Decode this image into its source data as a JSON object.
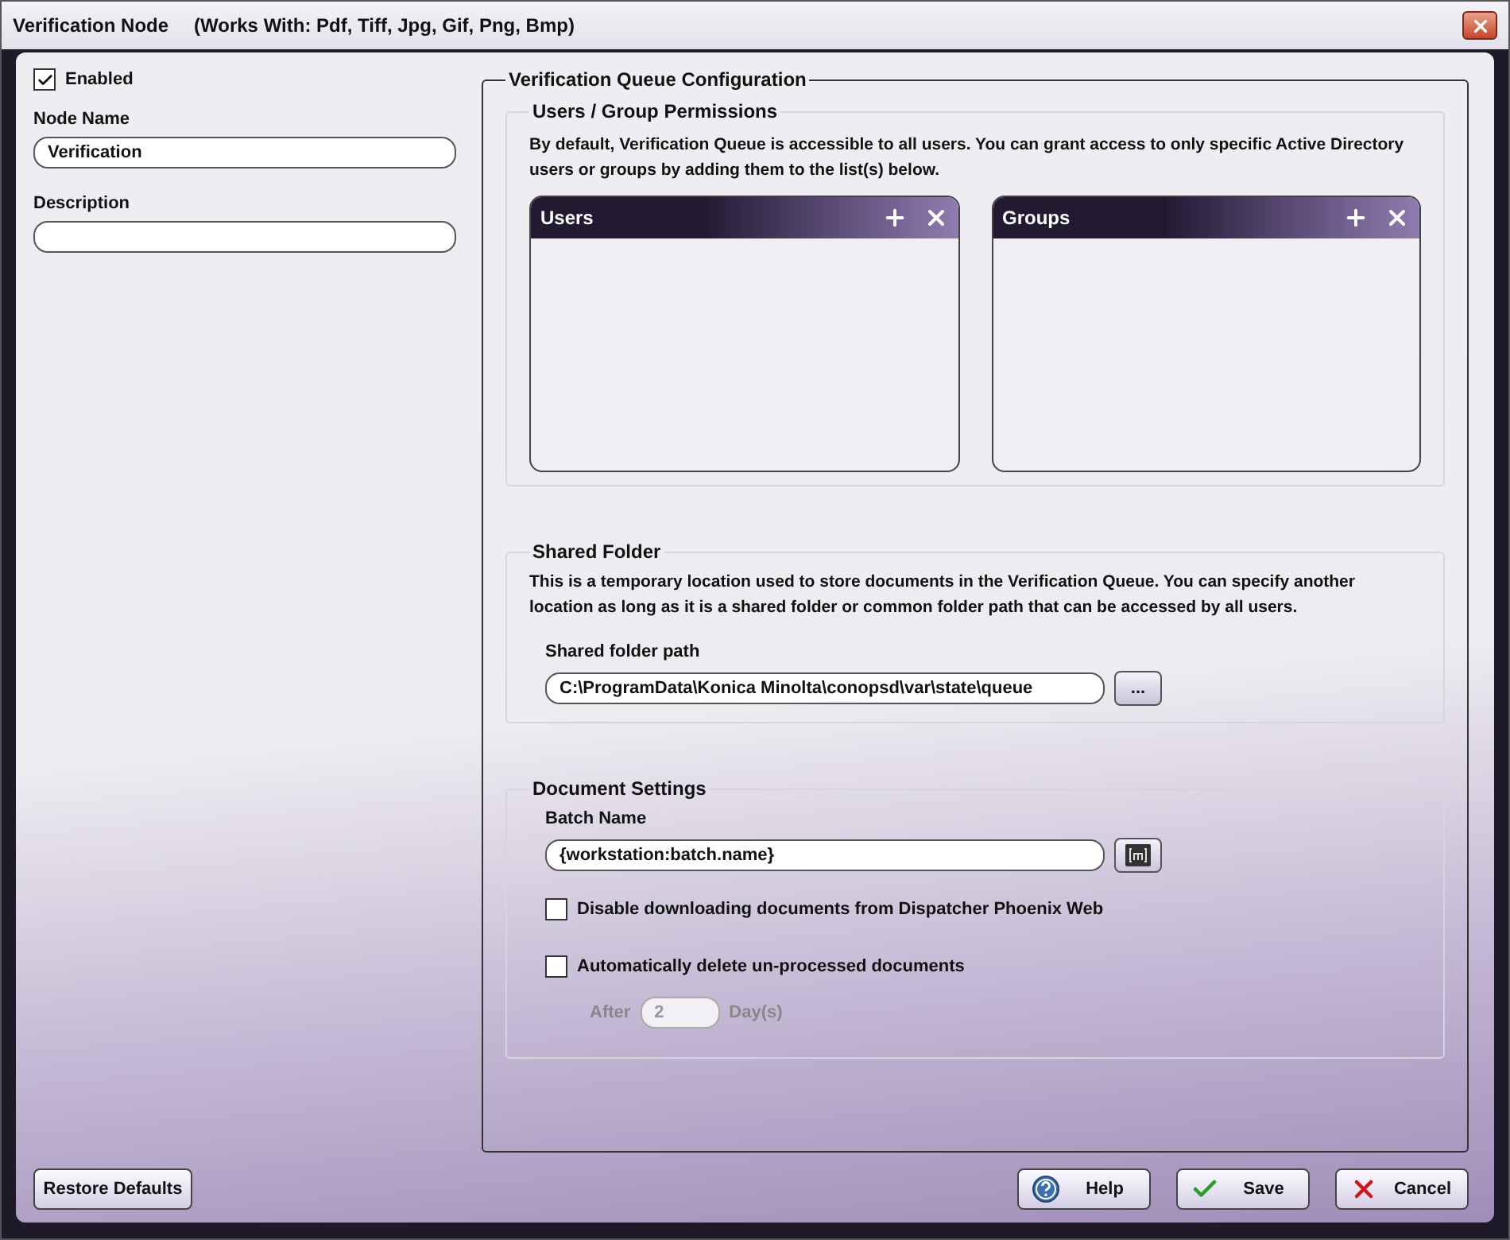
{
  "window": {
    "title": "Verification Node",
    "subtitle": "(Works With: Pdf, Tiff, Jpg, Gif, Png, Bmp)"
  },
  "general": {
    "enabled": {
      "label": "Enabled",
      "checked": true
    },
    "node_name": {
      "label": "Node Name",
      "value": "Verification"
    },
    "description": {
      "label": "Description"
    }
  },
  "config": {
    "title": "Verification Queue Configuration",
    "permissions": {
      "title": "Users / Group Permissions",
      "description": "By default, Verification Queue is accessible to all users. You can grant access to only specific Active Directory users or groups by adding them to the list(s) below.",
      "lists": [
        {
          "title": "Users"
        },
        {
          "title": "Groups"
        }
      ]
    },
    "shared_folder": {
      "title": "Shared Folder",
      "description": "This is a temporary location used to store documents in the Verification Queue. You can specify another location as long as it is a shared folder or common folder path that can be accessed by all users.",
      "path_label": "Shared folder path",
      "path_value": "C:\\ProgramData\\Konica Minolta\\conopsd\\var\\state\\queue",
      "browse_label": "..."
    },
    "document_settings": {
      "title": "Document Settings",
      "batch_label": "Batch Name",
      "batch_value": "{workstation:batch.name}",
      "options": [
        {
          "label": "Disable downloading documents from Dispatcher Phoenix Web",
          "checked": false
        },
        {
          "label": "Automatically delete un-processed documents",
          "checked": false
        }
      ],
      "after": {
        "label": "After",
        "value": "2",
        "unit": "Day(s)",
        "disabled": true
      }
    }
  },
  "buttons": [
    {
      "kind": "restore",
      "label": "Restore Defaults"
    },
    {
      "kind": "help",
      "label": "Help"
    },
    {
      "kind": "save",
      "label": "Save"
    },
    {
      "kind": "cancel",
      "label": "Cancel"
    }
  ]
}
